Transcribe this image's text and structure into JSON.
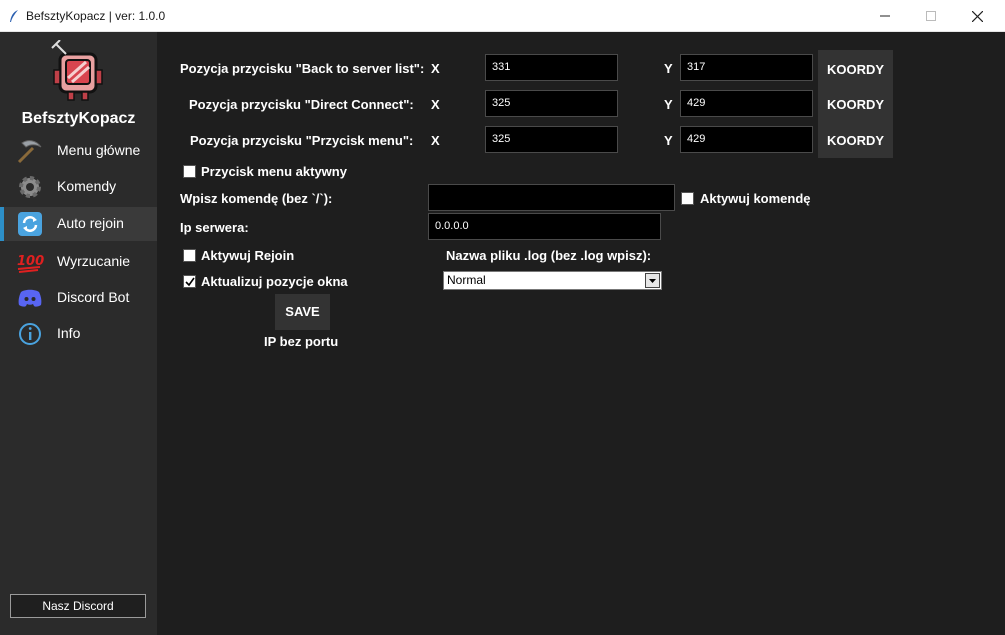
{
  "window": {
    "title": "BefsztyKopacz | ver: 1.0.0"
  },
  "sidebar": {
    "brand": "BefsztyKopacz",
    "items": [
      {
        "label": "Menu główne",
        "icon": "pickaxe-icon"
      },
      {
        "label": "Komendy",
        "icon": "gear-icon"
      },
      {
        "label": "Auto rejoin",
        "icon": "refresh-icon",
        "active": true
      },
      {
        "label": "Wyrzucanie",
        "icon": "hundred-points-icon"
      },
      {
        "label": "Discord Bot",
        "icon": "discord-icon"
      },
      {
        "label": "Info",
        "icon": "info-icon"
      }
    ],
    "discord_button": "Nasz Discord"
  },
  "positions": [
    {
      "label": "Pozycja przycisku \"Back to server list\":",
      "x_label": "X",
      "x": "331",
      "y_label": "Y",
      "y": "317",
      "button": "KOORDY"
    },
    {
      "label": "Pozycja przycisku \"Direct Connect\":",
      "x_label": "X",
      "x": "325",
      "y_label": "Y",
      "y": "429",
      "button": "KOORDY"
    },
    {
      "label": "Pozycja przycisku \"Przycisk menu\":",
      "x_label": "X",
      "x": "325",
      "y_label": "Y",
      "y": "429",
      "button": "KOORDY"
    }
  ],
  "menu_button_active": {
    "label": "Przycisk menu aktywny",
    "checked": false
  },
  "command": {
    "label": "Wpisz komendę (bez `/`):",
    "value": "",
    "activate_label": "Aktywuj komendę",
    "activate_checked": false
  },
  "server_ip": {
    "label": "Ip serwera:",
    "value": "0.0.0.0"
  },
  "rejoin": {
    "label": "Aktywuj Rejoin",
    "checked": false
  },
  "update_window": {
    "label": "Aktualizuj pozycje okna",
    "checked": true
  },
  "log_file": {
    "label": "Nazwa pliku .log (bez .log wpisz):",
    "selected": "Normal"
  },
  "save_button": "SAVE",
  "ip_hint": "IP bez portu",
  "colors": {
    "accent": "#2d8fc8",
    "sidebar_bg": "#2b2b2b",
    "main_bg": "#1e1e1e",
    "button_bg": "#333333"
  }
}
